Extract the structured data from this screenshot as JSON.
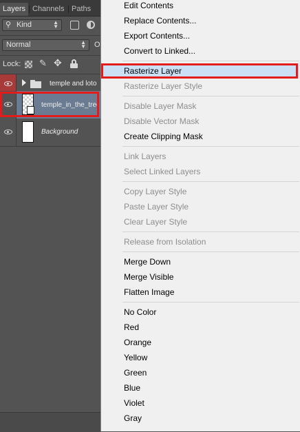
{
  "layers_panel": {
    "tabs": [
      "Layers",
      "Channels",
      "Paths"
    ],
    "filter_kind": "Kind",
    "blend_mode": "Normal",
    "opacity_label_partial": "O",
    "lock_label": "Lock:",
    "layers": [
      {
        "name": "temple and loto",
        "type": "group",
        "visible": true
      },
      {
        "name": "temple_in_the_tree",
        "type": "smart-object",
        "visible": true,
        "selected": true
      },
      {
        "name": "Background",
        "type": "background",
        "visible": true
      }
    ]
  },
  "context_menu": {
    "items": [
      {
        "label": "Edit Contents",
        "enabled": true
      },
      {
        "label": "Replace Contents...",
        "enabled": true
      },
      {
        "label": "Export Contents...",
        "enabled": true
      },
      {
        "label": "Convert to Linked...",
        "enabled": true
      },
      {
        "label": "Rasterize Layer",
        "enabled": true,
        "highlighted": true
      },
      {
        "label": "Rasterize Layer Style",
        "enabled": false
      },
      {
        "label": "Disable Layer Mask",
        "enabled": false
      },
      {
        "label": "Disable Vector Mask",
        "enabled": false
      },
      {
        "label": "Create Clipping Mask",
        "enabled": true
      },
      {
        "label": "Link Layers",
        "enabled": false
      },
      {
        "label": "Select Linked Layers",
        "enabled": false
      },
      {
        "label": "Copy Layer Style",
        "enabled": false
      },
      {
        "label": "Paste Layer Style",
        "enabled": false
      },
      {
        "label": "Clear Layer Style",
        "enabled": false
      },
      {
        "label": "Release from Isolation",
        "enabled": false
      },
      {
        "label": "Merge Down",
        "enabled": true
      },
      {
        "label": "Merge Visible",
        "enabled": true
      },
      {
        "label": "Flatten Image",
        "enabled": true
      },
      {
        "label": "No Color",
        "enabled": true
      },
      {
        "label": "Red",
        "enabled": true
      },
      {
        "label": "Orange",
        "enabled": true
      },
      {
        "label": "Yellow",
        "enabled": true
      },
      {
        "label": "Green",
        "enabled": true
      },
      {
        "label": "Blue",
        "enabled": true
      },
      {
        "label": "Violet",
        "enabled": true
      },
      {
        "label": "Gray",
        "enabled": true
      }
    ]
  },
  "colors": {
    "panel_bg": "#535353",
    "selected_layer": "#6a7b92",
    "menu_bg": "#f0f0f0",
    "menu_highlight": "#cce0f5",
    "annotation_red": "#e31b1b"
  }
}
